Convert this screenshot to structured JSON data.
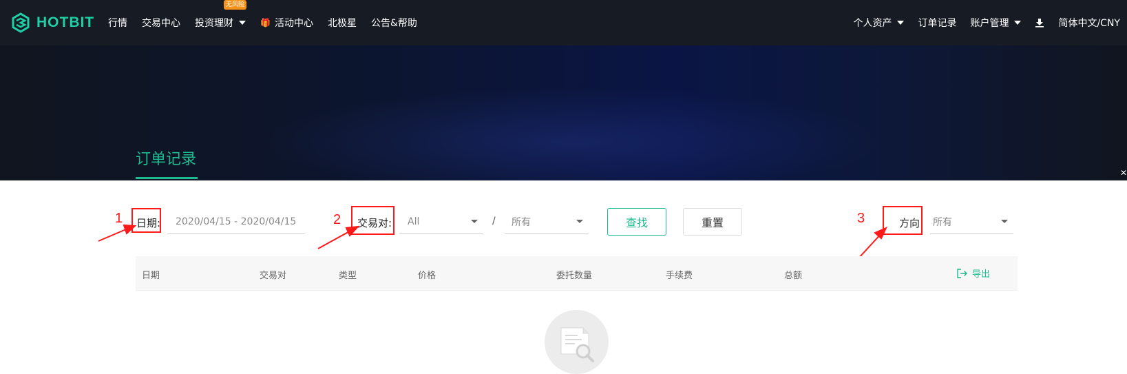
{
  "nav": {
    "brand": "HOTBIT",
    "items": [
      {
        "label": "行情"
      },
      {
        "label": "交易中心"
      },
      {
        "label": "投资理财",
        "badge": "无风险"
      },
      {
        "label": "活动中心"
      },
      {
        "label": "北极星"
      },
      {
        "label": "公告&帮助"
      }
    ],
    "right": {
      "assets": "个人资产",
      "orders": "订单记录",
      "account": "账户管理",
      "language": "简体中文/CNY"
    },
    "colors": {
      "bg": "#161b24",
      "accent": "#1fcfa5",
      "badge": "#f7931a"
    }
  },
  "banner": {
    "title": "订单记录"
  },
  "filters": {
    "date_label": "日期:",
    "date_value": "2020/04/15 - 2020/04/15",
    "pair_label": "交易对:",
    "pair_base_value": "All",
    "pair_quote_value": "所有",
    "search_button": "查找",
    "reset_button": "重置",
    "direction_label": "方向",
    "direction_value": "所有"
  },
  "annotations": [
    "1",
    "2",
    "3"
  ],
  "table": {
    "columns": [
      "日期",
      "交易对",
      "类型",
      "价格",
      "委托数量",
      "手续费",
      "总额"
    ],
    "export_label": "导出",
    "rows": []
  }
}
